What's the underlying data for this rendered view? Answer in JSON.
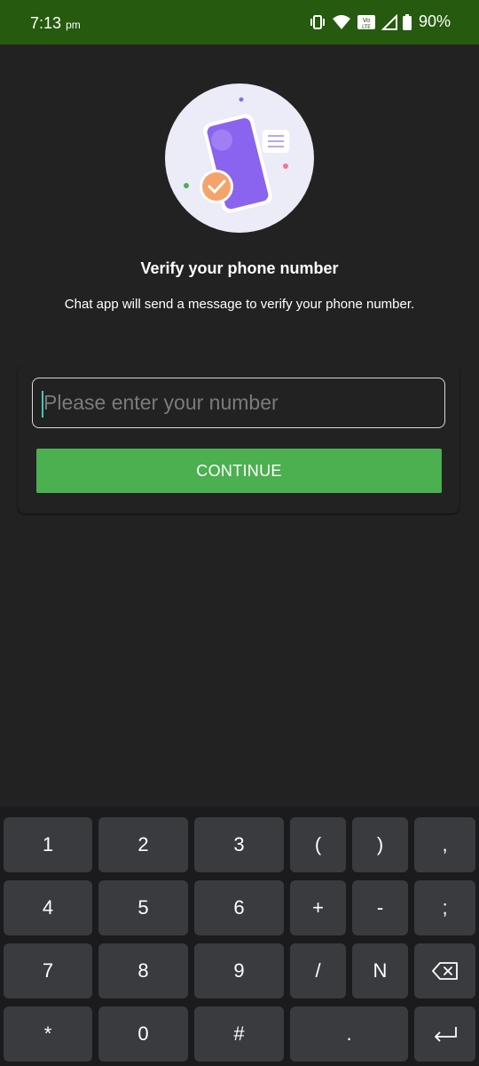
{
  "status_bar": {
    "time": "7:13",
    "ampm": "pm",
    "battery": "90%"
  },
  "verify": {
    "title": "Verify your phone number",
    "subtitle": "Chat app will send a message to verify your phone number.",
    "phone_placeholder": "Please enter your number",
    "continue_label": "CONTINUE"
  },
  "keyboard": {
    "row1": [
      "1",
      "2",
      "3",
      "(",
      ")",
      ","
    ],
    "row2": [
      "4",
      "5",
      "6",
      "+",
      "-",
      ";"
    ],
    "row3": [
      "7",
      "8",
      "9",
      "/",
      "N"
    ],
    "row4": [
      "*",
      "0",
      "#",
      "."
    ]
  },
  "colors": {
    "status_bar": "#265a0e",
    "accent": "#4caf50",
    "background": "#222222"
  }
}
